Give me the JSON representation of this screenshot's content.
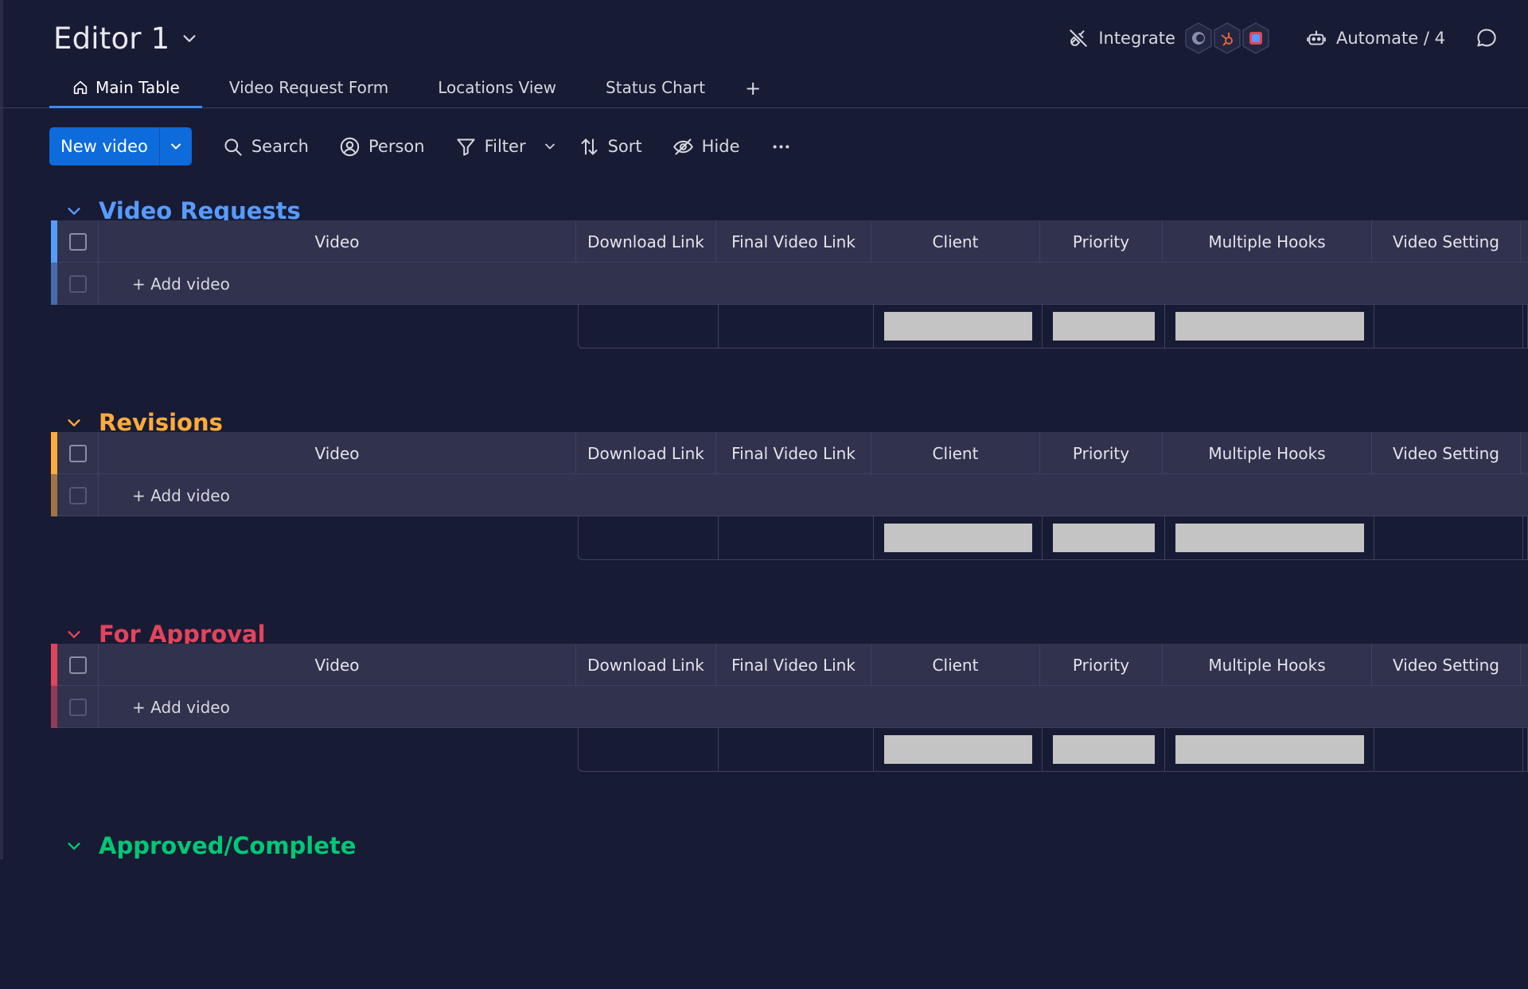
{
  "board": {
    "title": "Editor 1"
  },
  "header": {
    "integrate_label": "Integrate",
    "automate_label": "Automate / 4",
    "integration_icons": [
      "mailchimp-icon",
      "hubspot-icon",
      "app-icon"
    ]
  },
  "tabs": [
    {
      "label": "Main Table",
      "active": true
    },
    {
      "label": "Video Request Form",
      "active": false
    },
    {
      "label": "Locations View",
      "active": false
    },
    {
      "label": "Status Chart",
      "active": false
    }
  ],
  "tab_add_label": "+",
  "toolbar": {
    "new_label": "New video",
    "search_label": "Search",
    "person_label": "Person",
    "filter_label": "Filter",
    "sort_label": "Sort",
    "hide_label": "Hide"
  },
  "columns": [
    "Video",
    "Download Link",
    "Final Video Link",
    "Client",
    "Priority",
    "Multiple Hooks",
    "Video Setting"
  ],
  "add_item_label": "+ Add video",
  "groups": [
    {
      "title": "Video Requests",
      "color": "#579bfc"
    },
    {
      "title": "Revisions",
      "color": "#fdab3d"
    },
    {
      "title": "For Approval",
      "color": "#e2445c"
    },
    {
      "title": "Approved/Complete",
      "color": "#00c875"
    }
  ],
  "colors": {
    "background": "#181b34",
    "primary": "#0d6bdc",
    "tab_active": "#3d8cf0"
  }
}
